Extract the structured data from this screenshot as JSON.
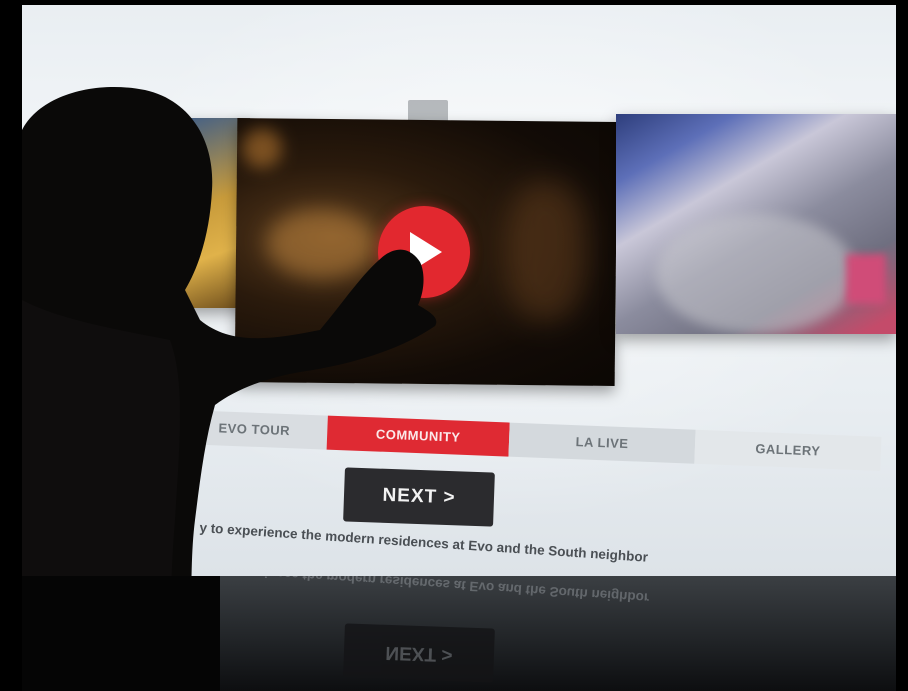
{
  "tabs": [
    {
      "label": "EVO TOUR",
      "active": false
    },
    {
      "label": "COMMUNITY",
      "active": true
    },
    {
      "label": "LA LIVE",
      "active": false
    },
    {
      "label": "GALLERY",
      "active": false
    }
  ],
  "next_button": {
    "label": "NEXT >"
  },
  "caption": "y to experience the modern residences at Evo and the South neighbor",
  "colors": {
    "accent": "#df2a33",
    "play": "#e2282f",
    "button": "#2b2b2e"
  },
  "icons": {
    "play": "play-icon"
  }
}
